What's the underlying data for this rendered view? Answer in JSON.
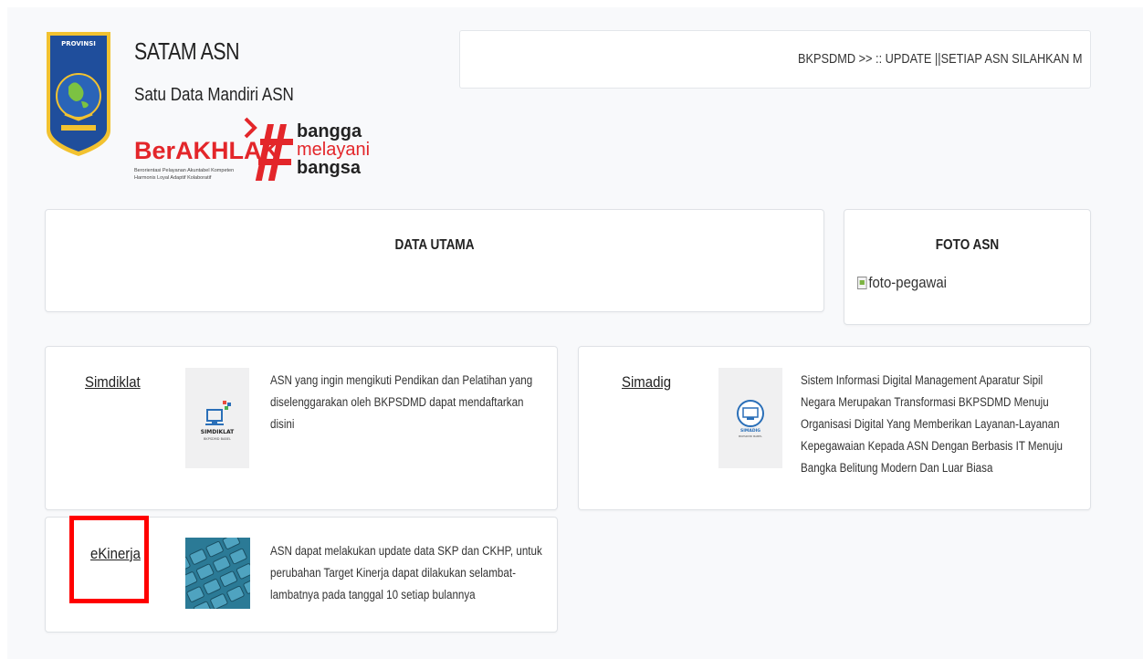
{
  "header": {
    "title": "SATAM ASN",
    "subtitle": "Satu Data Mandiri ASN",
    "province_logo_label": "PROVINSI",
    "berakhlak": {
      "word": "BerAKHLAK",
      "tagline_line1": "Berorientasi Pelayanan Akuntabel Kompeten",
      "tagline_line2": "Harmonis Loyal Adaptif Kolaboratif",
      "hashtag_1": "bangga",
      "hashtag_2": "melayani",
      "hashtag_3": "bangsa"
    }
  },
  "ticker": {
    "text": "BKPSDMD >> :: UPDATE ||SETIAP ASN SILAHKAN M"
  },
  "data_utama": {
    "title": "DATA UTAMA"
  },
  "foto_asn": {
    "title": "FOTO ASN",
    "image_alt": "foto-pegawai"
  },
  "apps": {
    "simdiklat": {
      "link": "Simdiklat",
      "thumb_label": "SIMDIKLAT",
      "thumb_sub": "BKPSDMD BABEL",
      "description": "ASN yang ingin mengikuti Pendikan dan Pelatihan yang diselenggarakan oleh BKPSDMD dapat mendaftarkan disini"
    },
    "simadig": {
      "link": "Simadig",
      "thumb_label": "SIMADIG",
      "thumb_sub": "BKPSDMD BABEL",
      "description": "Sistem Informasi Digital Management Aparatur Sipil Negara Merupakan Transformasi BKPSDMD Menuju Organisasi Digital Yang Memberikan Layanan-Layanan Kepegawaian Kepada ASN Dengan Berbasis IT Menuju Bangka Belitung Modern Dan Luar Biasa"
    },
    "ekinerja": {
      "link": "eKinerja",
      "description": "ASN dapat melakukan update data SKP dan CKHP, untuk perubahan Target Kinerja dapat dilakukan selambat-lambatnya pada tanggal 10 setiap bulannya"
    }
  },
  "colors": {
    "accent_red": "#e3262a",
    "highlight": "#ff0000",
    "shield_blue": "#1f4e9c",
    "shield_gold": "#f2c230"
  }
}
